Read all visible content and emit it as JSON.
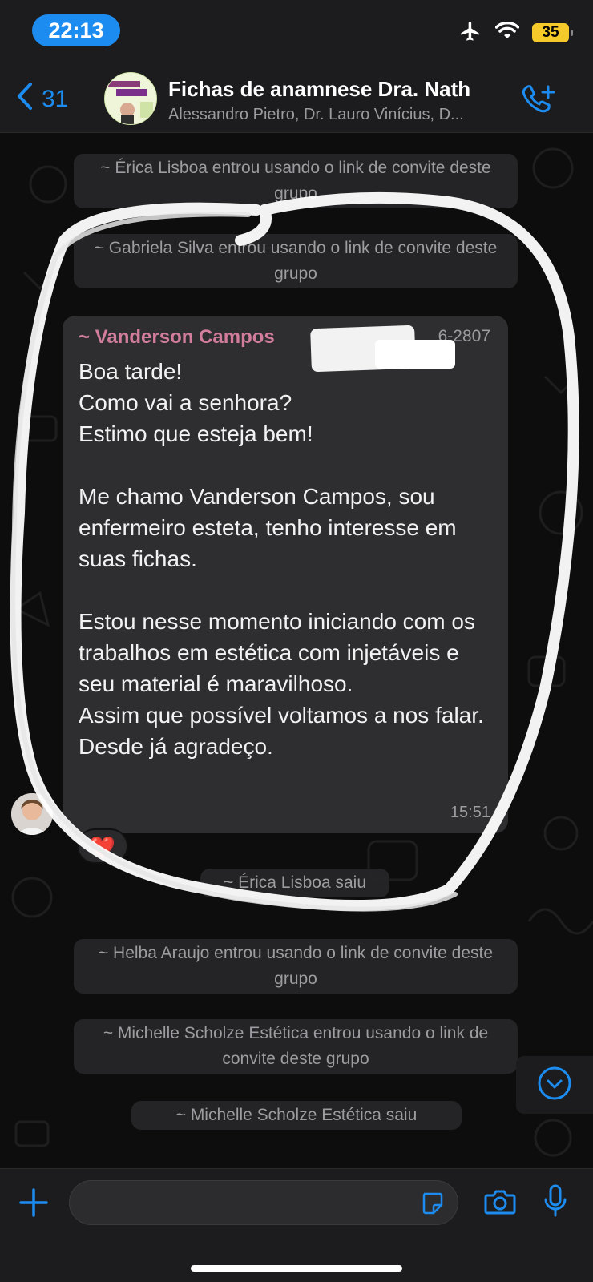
{
  "status_bar": {
    "time": "22:13",
    "battery": "35",
    "icons": [
      "airplane-icon",
      "wifi-icon",
      "battery-icon"
    ]
  },
  "header": {
    "back_count": "31",
    "title": "Fichas de anamnese Dra. Nath",
    "subtitle": "Alessandro Pietro, Dr. Lauro Vinícius, D...",
    "avatar_text_1": "FICHAS DE LUXO",
    "avatar_text_2": "Para Estética",
    "icons": [
      "back-chevron-icon",
      "add-call-icon"
    ]
  },
  "system_messages": [
    {
      "text": "~ Érica Lisboa entrou usando o link de convite deste grupo"
    },
    {
      "text": "~ Gabriela Silva entrou usando o link de convite deste grupo"
    },
    {
      "text": "~ Érica Lisboa saiu"
    },
    {
      "text": "~ Helba Araujo entrou usando o link de convite deste grupo"
    },
    {
      "text": "~ Michelle Scholze Estética entrou usando o link de convite deste grupo"
    },
    {
      "text": "~ Michelle Scholze Estética saiu"
    }
  ],
  "message": {
    "sender": "~ Vanderson Campos",
    "phone_partial": "6-2807",
    "text": "Boa tarde!\nComo vai a senhora?\nEstimo que esteja bem!\n\nMe chamo Vanderson Campos, sou enfermeiro esteta, tenho interesse em suas fichas.\n\nEstou nesse momento iniciando com os trabalhos em estética com injetáveis e seu material é maravilhoso.\nAssim que possível voltamos a nos falar.\nDesde já agradeço.",
    "time": "15:51",
    "reaction": "❤️"
  },
  "colors": {
    "accent": "#1d8cf0",
    "sender_name": "#d27d9c",
    "bubble": "#2e2e30",
    "battery": "#f5c92a"
  }
}
